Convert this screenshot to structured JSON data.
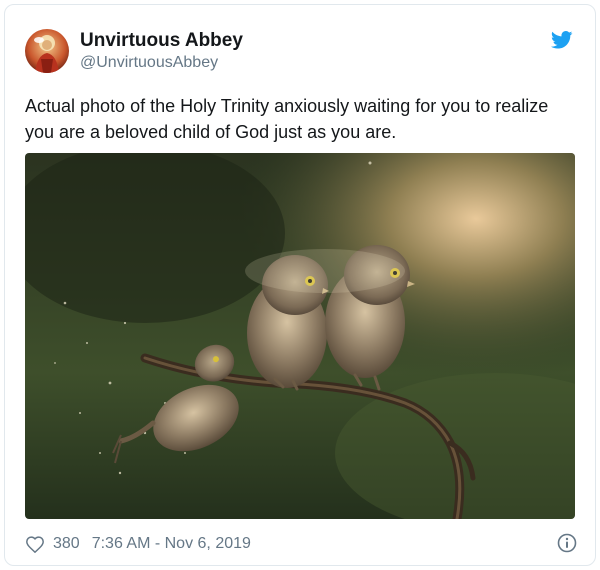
{
  "tweet": {
    "author": {
      "display_name": "Unvirtuous Abbey",
      "handle": "@UnvirtuousAbbey"
    },
    "text": "Actual photo of the Holy Trinity anxiously waiting for you to realize you are a beloved child of God just as you are.",
    "likes": "380",
    "timestamp": "7:36 AM - Nov 6, 2019"
  },
  "icons": {
    "brand": "twitter-bird-icon",
    "like": "heart-icon",
    "info": "info-icon"
  },
  "colors": {
    "brand_blue": "#1da1f2",
    "muted_text": "#657786",
    "border": "#e1e8ed"
  }
}
